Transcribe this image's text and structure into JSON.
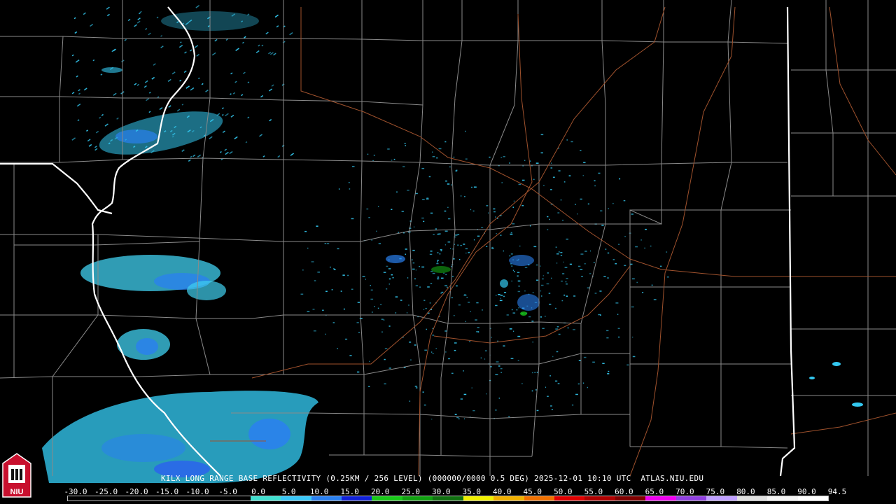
{
  "map": {
    "caption": "KILX LONG RANGE BASE REFLECTIVITY (0.25KM / 256 LEVEL) (000000/0000 0.5 DEG) 2025-12-01 10:10 UTC  ATLAS.NIU.EDU",
    "logo_text": "NIU",
    "colors": {
      "background": "#000000",
      "county_lines": "#8a8a8a",
      "state_lines": "#ffffff",
      "highways": "#a0522d",
      "echo_light": "#33c8f0",
      "echo_mid": "#2a80f0",
      "echo_heavy": "#1e40e0"
    }
  },
  "legend": {
    "ticks": [
      "-30.0",
      "-25.0",
      "-20.0",
      "-15.0",
      "-10.0",
      "-5.0",
      "0.0",
      "5.0",
      "10.0",
      "15.0",
      "20.0",
      "25.0",
      "30.0",
      "35.0",
      "40.0",
      "45.0",
      "50.0",
      "55.0",
      "60.0",
      "65.0",
      "70.0",
      "75.0",
      "80.0",
      "85.0",
      "90.0",
      "94.5"
    ],
    "colors": [
      "#000000",
      "#000000",
      "#000000",
      "#000000",
      "#000000",
      "#000000",
      "#40e0d0",
      "#3ac8f8",
      "#2a80f0",
      "#1020d8",
      "#18c818",
      "#10a010",
      "#107010",
      "#f0f000",
      "#f0b000",
      "#f07000",
      "#e00000",
      "#b00000",
      "#800000",
      "#f000f0",
      "#9040e0",
      "#c0a0ff",
      "#e0e0e0",
      "#f4f4f4",
      "#ffffff"
    ]
  }
}
